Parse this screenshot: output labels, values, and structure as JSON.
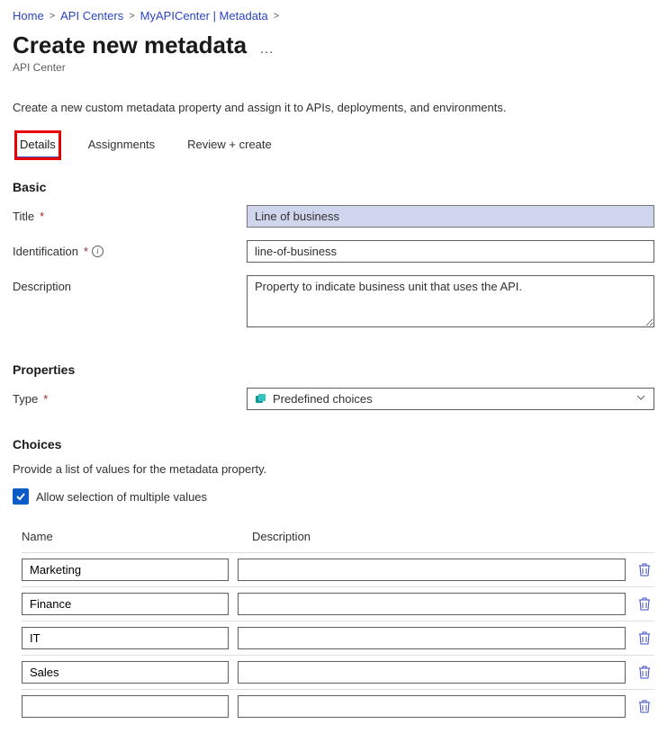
{
  "breadcrumb": {
    "items": [
      "Home",
      "API Centers",
      "MyAPICenter | Metadata"
    ]
  },
  "header": {
    "title": "Create new metadata",
    "subtitle": "API Center"
  },
  "intro": "Create a new custom metadata property and assign it to APIs, deployments, and environments.",
  "tabs": {
    "items": [
      {
        "label": "Details",
        "active": true
      },
      {
        "label": "Assignments",
        "active": false
      },
      {
        "label": "Review + create",
        "active": false
      }
    ]
  },
  "basic": {
    "heading": "Basic",
    "title_label": "Title",
    "title_value": "Line of business",
    "identification_label": "Identification",
    "identification_value": "line-of-business",
    "description_label": "Description",
    "description_value": "Property to indicate business unit that uses the API."
  },
  "properties": {
    "heading": "Properties",
    "type_label": "Type",
    "type_value": "Predefined choices"
  },
  "choices": {
    "heading": "Choices",
    "description": "Provide a list of values for the metadata property.",
    "allow_multiple_label": "Allow selection of multiple values",
    "allow_multiple_checked": true,
    "columns": {
      "name": "Name",
      "description": "Description"
    },
    "rows": [
      {
        "name": "Marketing",
        "description": ""
      },
      {
        "name": "Finance",
        "description": ""
      },
      {
        "name": "IT",
        "description": ""
      },
      {
        "name": "Sales",
        "description": ""
      },
      {
        "name": "",
        "description": ""
      }
    ]
  }
}
